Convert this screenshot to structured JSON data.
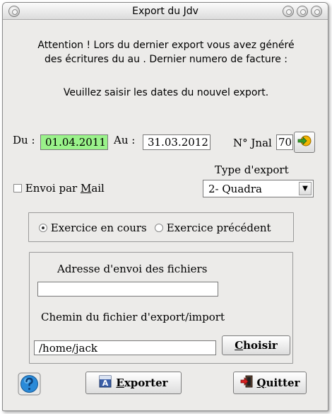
{
  "window": {
    "title": "Export du Jdv"
  },
  "message": {
    "line1": "Attention ! Lors du dernier export vous avez généré",
    "line2": "des écritures du au . Dernier numero de facture :",
    "line3": "Veuillez saisir les dates du nouvel export."
  },
  "dates": {
    "du_label": "Du :",
    "du_value": "01.04.2011",
    "au_label": "Au :",
    "au_value": "31.03.2012"
  },
  "journal": {
    "label": "N° Jnal",
    "value": "70"
  },
  "export_type": {
    "label": "Type d'export",
    "selected": "2- Quadra"
  },
  "mail": {
    "prefix": "Envoi par ",
    "underlined": "M",
    "suffix": "ail",
    "checked": false
  },
  "exercice": {
    "option1": "Exercice en cours",
    "option2": "Exercice précédent",
    "selected": "option1"
  },
  "files": {
    "address_label": "Adresse d'envoi des fichiers",
    "address_value": "",
    "path_label": "Chemin du fichier d'export/import",
    "path_value": "/home/jack",
    "choose_underlined": "C",
    "choose_rest": "hoisir"
  },
  "buttons": {
    "export_underlined": "E",
    "export_rest": "xporter",
    "quit_underlined": "Q",
    "quit_rest": "uitter"
  },
  "colors": {
    "date_field_bg": "#9af28a",
    "window_bg": "#ecebe9"
  }
}
